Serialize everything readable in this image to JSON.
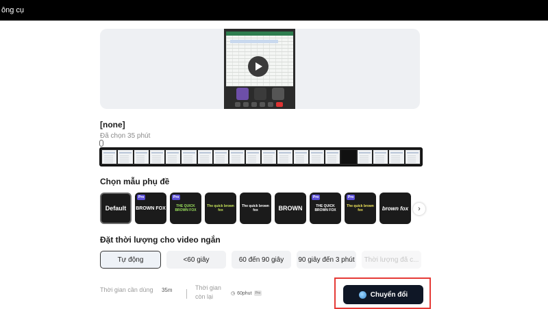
{
  "topbar": {
    "title": "ông cụ"
  },
  "video": {
    "title": "[none]",
    "selected_info": "Đã chọn 35 phút"
  },
  "caption_section": {
    "heading": "Chọn mẫu phụ đề",
    "styles": [
      {
        "label": "Default",
        "selected": true,
        "pro": false
      },
      {
        "label": "BROWN FOX",
        "pro": true
      },
      {
        "label": "THE QUICK BROWN FOX",
        "pro": true
      },
      {
        "label": "The quick brown fox",
        "pro": false
      },
      {
        "label": "The quick brown fox",
        "pro": false
      },
      {
        "label": "BROWN",
        "pro": false
      },
      {
        "label": "THE QUICK BROWN FOX",
        "pro": true
      },
      {
        "label": "The quick brown fox",
        "pro": true
      },
      {
        "label": "brown fox",
        "pro": false
      }
    ],
    "pro_badge": "Pro"
  },
  "duration_section": {
    "heading": "Đặt thời lượng cho video ngắn",
    "options": [
      {
        "label": "Tự động",
        "selected": true
      },
      {
        "label": "<60 giây"
      },
      {
        "label": "60 đến 90 giây"
      },
      {
        "label": "90 giây đến 3 phút"
      },
      {
        "label": "Thời lượng đã c...",
        "disabled": true
      }
    ]
  },
  "footer": {
    "time_needed_label": "Thời gian cần dùng",
    "time_needed_value": "35m",
    "time_left_label": "Thời gian còn lại",
    "time_left_value": "60phut",
    "pro_badge": "Pro"
  },
  "convert_button": {
    "label": "Chuyển đổi"
  },
  "colors": {
    "accent_dark": "#0f1726",
    "highlight_box": "#e53935",
    "pro_badge": "#5b4fd6"
  }
}
